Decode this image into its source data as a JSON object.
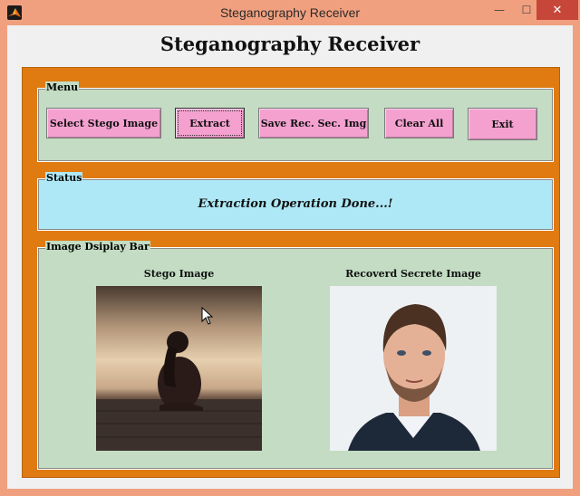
{
  "window": {
    "title": "Steganography Receiver",
    "controls": {
      "minimize": "—",
      "maximize": "☐",
      "close": "✕"
    }
  },
  "heading": "Steganography Receiver",
  "menu": {
    "label": "Menu",
    "buttons": {
      "select": "Select Stego Image",
      "extract": "Extract",
      "save": "Save Rec. Sec. Img",
      "clear": "Clear All",
      "exit": "Exit"
    }
  },
  "status": {
    "label": "Status",
    "message": "Extraction Operation Done...!"
  },
  "image_bar": {
    "label": "Image Dsiplay Bar",
    "stego_caption": "Stego Image",
    "recovered_caption": "Recoverd Secrete Image"
  },
  "icons": {
    "app": "matlab-icon",
    "cursor": "mouse-pointer-icon"
  },
  "colors": {
    "window_frame": "#f1a07f",
    "panel": "#e07b12",
    "group_bg": "#c3dcc3",
    "status_bg": "#aee8f6",
    "button_bg": "#f4a1cf",
    "close_button": "#c7463a"
  }
}
